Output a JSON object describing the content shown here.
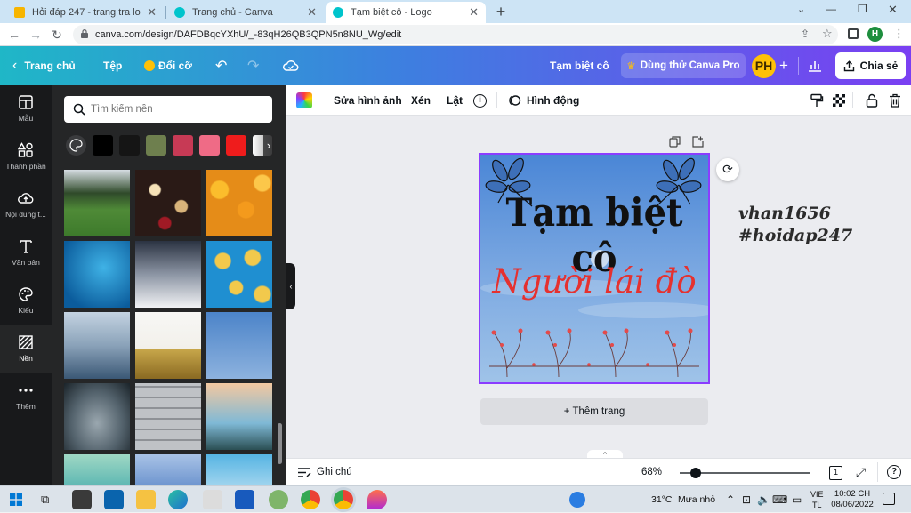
{
  "browser": {
    "tabs": [
      {
        "title": "Hỏi đáp 247 - trang tra loi",
        "active": false,
        "favicon_color": "#f7b500"
      },
      {
        "title": "Trang chủ - Canva",
        "active": false,
        "favicon_color": "#00c4cc"
      },
      {
        "title": "Tạm biệt cô - Logo",
        "active": true,
        "favicon_color": "#00c4cc"
      }
    ],
    "new_tab_symbol": "+",
    "url": "canva.com/design/DAFDBqcYXhU/_-83qH26QB3QPN5n8NU_Wg/edit",
    "profile_initial": "H",
    "profile_color": "#1e8e3e"
  },
  "canva_header": {
    "home_label": "Trang chủ",
    "file_label": "Tệp",
    "resize_label": "Đổi cỡ",
    "design_title": "Tạm biệt cô",
    "trial_label": "Dùng thử Canva Pro",
    "avatar_initials": "PH",
    "share_label": "Chia sẻ"
  },
  "rail": {
    "items": [
      {
        "label": "Mẫu",
        "icon": "template-icon"
      },
      {
        "label": "Thành phần",
        "icon": "elements-icon"
      },
      {
        "label": "Nội dung t...",
        "icon": "upload-icon"
      },
      {
        "label": "Văn bản",
        "icon": "text-icon"
      },
      {
        "label": "Kiểu",
        "icon": "palette-icon"
      },
      {
        "label": "Nền",
        "icon": "background-icon"
      },
      {
        "label": "Thêm",
        "icon": "more-icon"
      }
    ],
    "active_index": 5
  },
  "panel": {
    "search_placeholder": "Tìm kiếm nền",
    "swatches": [
      "#000000",
      "#151515",
      "#6e7f4e",
      "#c73a55",
      "#ef6b86",
      "#ef1c1c"
    ],
    "thumbnails": [
      "forest-hill",
      "bokeh-lights",
      "orange-flowers",
      "blue-texture",
      "snow-dandelion",
      "lemon-slices",
      "misty-mountains",
      "pineapples",
      "blue-sky-moon",
      "earth-clouds",
      "white-brick",
      "palm-trees",
      "teal-gradient",
      "blue-bokeh",
      "sky-gradient"
    ]
  },
  "toolbar": {
    "edit_image_label": "Sửa hình ảnh",
    "crop_label": "Xén",
    "flip_label": "Lật",
    "animate_label": "Hình động"
  },
  "canvas": {
    "headline": "Tạm biệt cô",
    "subtitle": "Người lái đò",
    "bg_top": "#4a86d6",
    "bg_bottom": "#9fc3e8",
    "subtitle_color": "#e5312f",
    "add_page_label": "+ Thêm trang"
  },
  "watermark": {
    "line1": "vhan1656",
    "line2": "#hoidap247"
  },
  "bottombar": {
    "notes_label": "Ghi chú",
    "zoom": "68%",
    "zoom_fraction": 0.12,
    "page_count": "1",
    "help_symbol": "?"
  },
  "taskbar": {
    "temperature": "31°C",
    "weather": "Mưa nhỏ",
    "lang_line1": "VIE",
    "lang_line2": "TL",
    "time": "10:02 CH",
    "date": "08/06/2022"
  }
}
